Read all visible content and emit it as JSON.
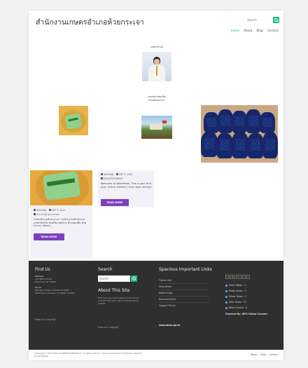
{
  "header": {
    "site_title": "สำนักงานเกษตรอำเภอห้วยกระเจา",
    "search_placeholder": "Search",
    "nav": [
      {
        "label": "Home",
        "active": true
      },
      {
        "label": "About"
      },
      {
        "label": "Blog"
      },
      {
        "label": "Contact"
      }
    ]
  },
  "content": {
    "portrait_caption": "เกษตรอำเภอ",
    "field_caption_1": "เกษตรตำบลดงเย็น",
    "field_caption_2": "ตำบลห้วยกระเจา"
  },
  "posts": [
    {
      "author": "WICHIAN",
      "date": "SEP 5, 2023",
      "category": "สาระน่ารู้ด้านการเกษตร",
      "excerpt": "เกษตรอำเภอห้วยกระเจา ร่วมกิจกรรมสำนักงานเกษตรจังหวัด ส่งเสริมเกษตรกร ตำบลดงเย็น ห้วยกระเจา others",
      "read_more": "READ MORE"
    },
    {
      "author": "WICHIAN",
      "date": "SEP 5, 2023",
      "category": "UNCATEGORIZED",
      "excerpt": "Welcome to WordPress. This is your first post. Edit or delete it, then start writing!",
      "read_more": "READ MORE"
    }
  ],
  "footer": {
    "find_us": {
      "title": "Find Us",
      "address_label": "Address",
      "address": [
        "123 Main Street",
        "New York, NY 10001"
      ],
      "hours_label": "Hours",
      "hours": [
        "Monday–Friday: 9:00AM–5:00PM",
        "Saturday & Sunday: 11:00AM–3:00PM"
      ],
      "extra": "ห้วยกระเจา กาญจนบุรี"
    },
    "search": {
      "title": "Search",
      "placeholder": "Search"
    },
    "about": {
      "title": "About This Site",
      "text": [
        "This may be a good place to introduce",
        "yourself and your site or include some",
        "credits."
      ],
      "extra": "ห้วยกระเจา กาญจนบุรี"
    },
    "links": {
      "title": "Spacious Important Links",
      "items": [
        "Theme Info",
        "View Demo",
        "Report Bugs",
        "Documentation",
        "Support Forum"
      ],
      "extra": "www.moac.go.th"
    },
    "visitors": {
      "counter": [
        "0",
        "0",
        "0",
        "3",
        "2",
        "1"
      ],
      "stats": [
        "Users Today : 1",
        "Today Views : 3",
        "Views Today : 1",
        "Total views : 73",
        "Who's Online : 0"
      ],
      "powered": "Powered By: WPS Visitor Counter"
    }
  },
  "bottom": {
    "copyright_1": "Copyright © 2024 สำนักงานเกษตรอำเภอห้วยกระเจา. All rights reserved. Theme Spacious by ThemeGrill. Powered",
    "copyright_2": "by: WordPress.",
    "nav": [
      "About",
      "Blog",
      "Contact"
    ]
  },
  "colors": {
    "accent": "#1abc7b",
    "button": "#7b3fbf",
    "footer_bg": "#2f2f2f"
  }
}
